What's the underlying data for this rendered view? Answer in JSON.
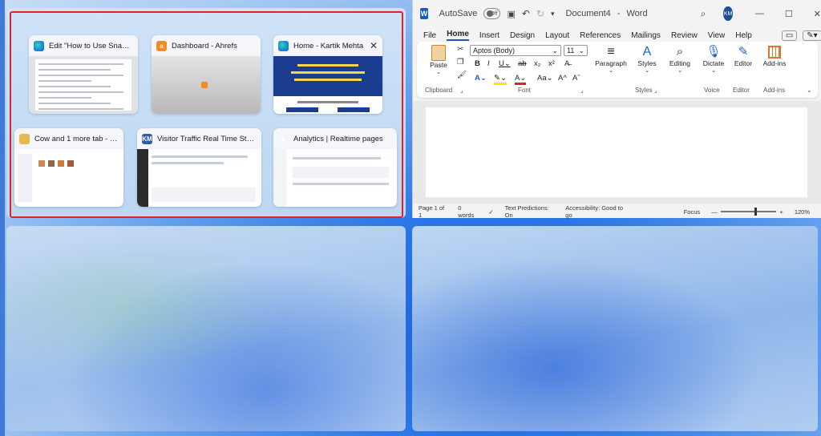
{
  "snap_assist": {
    "tiles": [
      {
        "title": "Edit \"How to Use Snap Lay...",
        "icon": "edge-icon"
      },
      {
        "title": "Dashboard - Ahrefs",
        "icon": "ahrefs-icon"
      },
      {
        "title": "Home - Kartik Mehta",
        "icon": "edge-icon",
        "close": "✕"
      },
      {
        "title": "Cow and 1 more tab - File E...",
        "icon": "file-explorer-icon"
      },
      {
        "title": "Visitor Traffic Real Time Statistic...",
        "icon": "km-icon",
        "icon_text": "KM"
      },
      {
        "title": "Analytics | Realtime pages",
        "icon": "analytics-icon"
      }
    ]
  },
  "word": {
    "autosave_label": "AutoSave",
    "autosave_state": "Off",
    "doc_title": "Document4",
    "app_name": "Word",
    "avatar": "KM",
    "tabs": [
      "File",
      "Home",
      "Insert",
      "Design",
      "Layout",
      "References",
      "Mailings",
      "Review",
      "View",
      "Help"
    ],
    "ribbon": {
      "paste": "Paste",
      "clipboard": "Clipboard",
      "font_name": "Aptos (Body)",
      "font_size": "11",
      "font": "Font",
      "paragraph": "Paragraph",
      "styles_btn": "Styles",
      "styles": "Styles",
      "editing": "Editing",
      "dictate": "Dictate",
      "voice": "Voice",
      "editor_btn": "Editor",
      "editor": "Editor",
      "addins_btn": "Add-ins",
      "addins": "Add-ins"
    },
    "status": {
      "page": "Page 1 of 1",
      "words": "0 words",
      "text_predictions": "Text Predictions: On",
      "accessibility": "Accessibility: Good to go",
      "focus": "Focus",
      "zoom": "120%"
    }
  }
}
